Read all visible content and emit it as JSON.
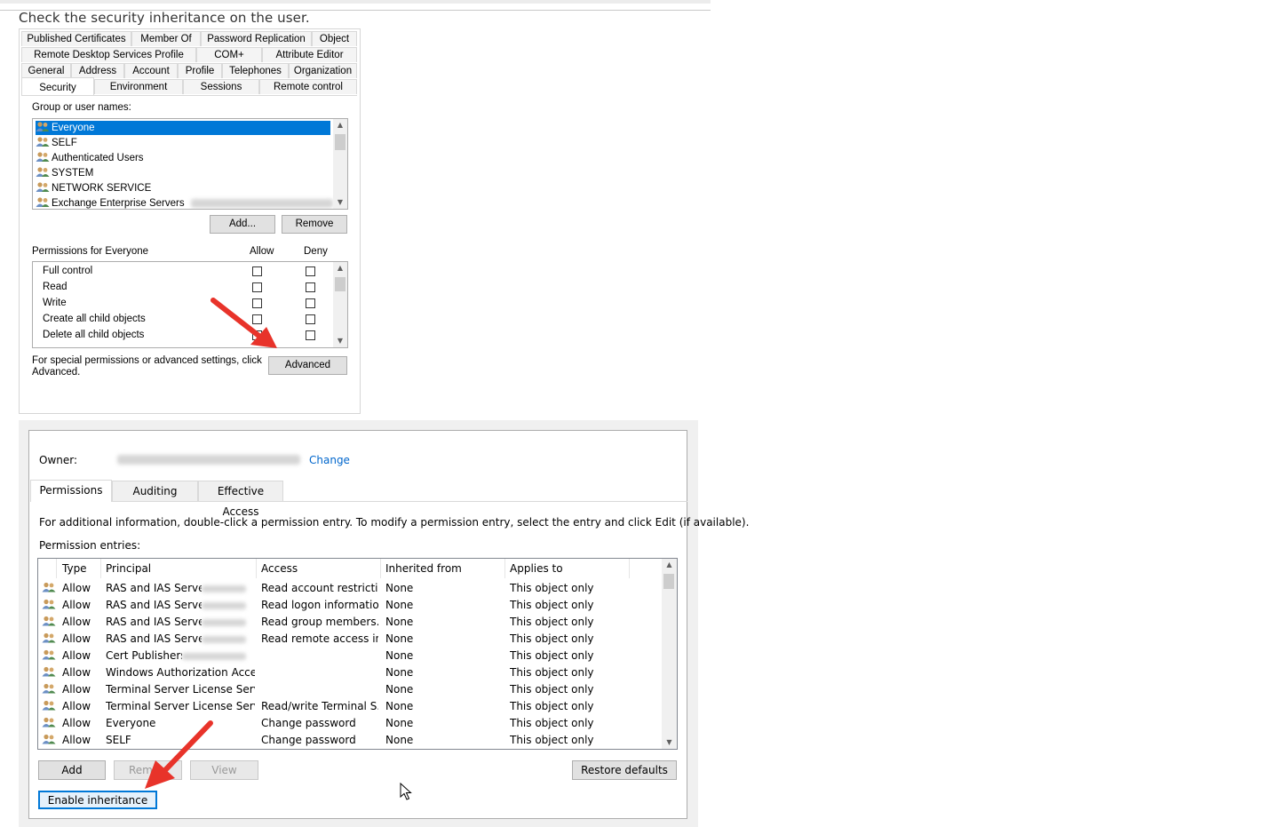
{
  "caption": "Check the security inheritance on the user.",
  "dialog1": {
    "tabs_row1": [
      "Published Certificates",
      "Member Of",
      "Password Replication",
      "Object"
    ],
    "tabs_row2": [
      "Remote Desktop Services Profile",
      "COM+",
      "Attribute Editor"
    ],
    "tabs_row3": [
      "General",
      "Address",
      "Account",
      "Profile",
      "Telephones",
      "Organization"
    ],
    "tabs_row4": [
      "Security",
      "Environment",
      "Sessions",
      "Remote control"
    ],
    "group_label": "Group or user names:",
    "groups": [
      "Everyone",
      "SELF",
      "Authenticated Users",
      "SYSTEM",
      "NETWORK SERVICE",
      "Exchange Enterprise Servers"
    ],
    "add_button": "Add...",
    "remove_button": "Remove",
    "permissions_label": "Permissions for Everyone",
    "allow_label": "Allow",
    "deny_label": "Deny",
    "permissions": [
      "Full control",
      "Read",
      "Write",
      "Create all child objects",
      "Delete all child objects"
    ],
    "advanced_text_line1": "For special permissions or advanced settings, click",
    "advanced_text_line2": "Advanced.",
    "advanced_button": "Advanced"
  },
  "dialog2": {
    "owner_label": "Owner:",
    "change_link": "Change",
    "tabs": [
      "Permissions",
      "Auditing",
      "Effective Access"
    ],
    "info_text": "For additional information, double-click a permission entry. To modify a permission entry, select the entry and click Edit (if available).",
    "entries_label": "Permission entries:",
    "columns": [
      "Type",
      "Principal",
      "Access",
      "Inherited from",
      "Applies to"
    ],
    "rows": [
      {
        "type": "Allow",
        "principal": "RAS and IAS Servers",
        "access": "Read account restricti...",
        "inherited": "None",
        "applies": "This object only"
      },
      {
        "type": "Allow",
        "principal": "RAS and IAS Servers",
        "access": "Read logon information",
        "inherited": "None",
        "applies": "This object only"
      },
      {
        "type": "Allow",
        "principal": "RAS and IAS Servers",
        "access": "Read group members...",
        "inherited": "None",
        "applies": "This object only"
      },
      {
        "type": "Allow",
        "principal": "RAS and IAS Servers",
        "access": "Read remote access in...",
        "inherited": "None",
        "applies": "This object only"
      },
      {
        "type": "Allow",
        "principal": "Cert Publishers",
        "access": "",
        "inherited": "None",
        "applies": "This object only"
      },
      {
        "type": "Allow",
        "principal": "Windows Authorization Acce...",
        "access": "",
        "inherited": "None",
        "applies": "This object only"
      },
      {
        "type": "Allow",
        "principal": "Terminal Server License Serve...",
        "access": "",
        "inherited": "None",
        "applies": "This object only"
      },
      {
        "type": "Allow",
        "principal": "Terminal Server License Serve...",
        "access": "Read/write Terminal S...",
        "inherited": "None",
        "applies": "This object only"
      },
      {
        "type": "Allow",
        "principal": "Everyone",
        "access": "Change password",
        "inherited": "None",
        "applies": "This object only"
      },
      {
        "type": "Allow",
        "principal": "SELF",
        "access": "Change password",
        "inherited": "None",
        "applies": "This object only"
      }
    ],
    "add_button": "Add",
    "remove_button": "Rem",
    "view_button": "View",
    "restore_button": "Restore defaults",
    "enable_inheritance_button": "Enable inheritance"
  },
  "colors": {
    "selection": "#0078d7",
    "arrow": "#e8332a",
    "link": "#0066cc"
  }
}
